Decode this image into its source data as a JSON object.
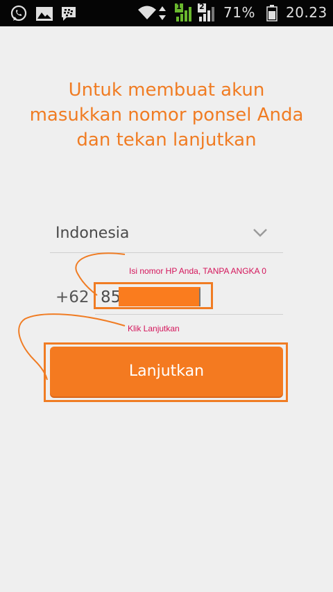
{
  "status_bar": {
    "battery_percent": "71%",
    "time": "20.23",
    "sim1_label": "1",
    "sim2_label": "2",
    "icons": [
      "whatsapp-icon",
      "gallery-icon",
      "bbm-icon",
      "wifi-icon",
      "signal-sim1-icon",
      "signal-sim2-icon",
      "battery-icon"
    ]
  },
  "main": {
    "headline": "Untuk membuat akun masukkan nomor ponsel Anda dan tekan lanjutkan",
    "country": "Indonesia",
    "country_code": "+62",
    "phone_value": "85",
    "continue_label": "Lanjutkan"
  },
  "annotations": {
    "phone_note": "Isi nomor HP Anda, TANPA ANGKA 0",
    "button_note": "Klik Lanjutkan"
  },
  "colors": {
    "accent": "#f47a20",
    "annotation_text": "#d4145a",
    "background": "#efefef"
  }
}
